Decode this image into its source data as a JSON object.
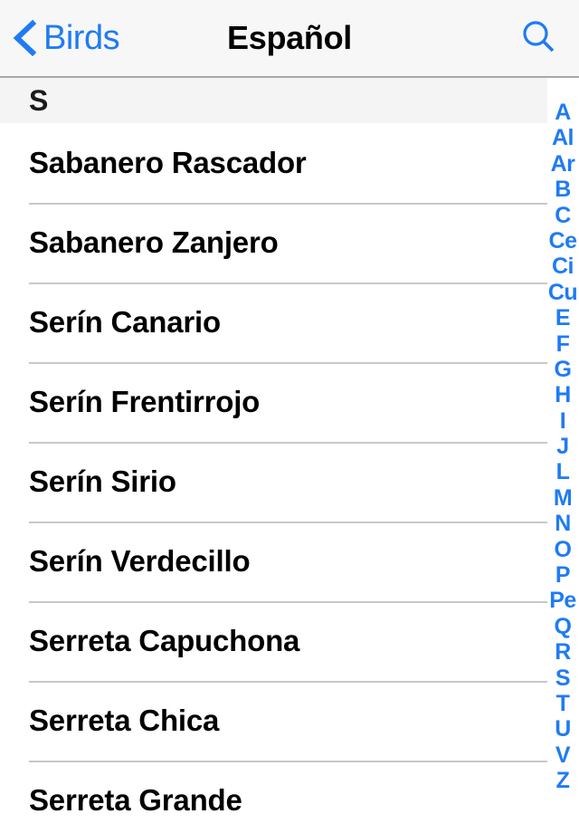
{
  "navbar": {
    "back_label": "Birds",
    "back_icon": "chevron-left-icon",
    "title": "Español",
    "search_icon": "search-icon",
    "tint_color": "#1f7bf4",
    "background_color": "#f7f7f7"
  },
  "section": {
    "header": "S",
    "header_background": "#f4f4f4"
  },
  "list": {
    "items": [
      {
        "label": "Sabanero Rascador"
      },
      {
        "label": "Sabanero Zanjero"
      },
      {
        "label": "Serín Canario"
      },
      {
        "label": "Serín Frentirrojo"
      },
      {
        "label": "Serín Sirio"
      },
      {
        "label": "Serín Verdecillo"
      },
      {
        "label": "Serreta Capuchona"
      },
      {
        "label": "Serreta Chica"
      },
      {
        "label": "Serreta Grande"
      }
    ],
    "separator_color": "#c8c7cc",
    "text_color": "#000000"
  },
  "index_bar": {
    "color": "#1f7bf4",
    "entries": [
      "A",
      "Al",
      "Ar",
      "B",
      "C",
      "Ce",
      "Ci",
      "Cu",
      "E",
      "F",
      "G",
      "H",
      "I",
      "J",
      "L",
      "M",
      "N",
      "O",
      "P",
      "Pe",
      "Q",
      "R",
      "S",
      "T",
      "U",
      "V",
      "Z"
    ]
  }
}
